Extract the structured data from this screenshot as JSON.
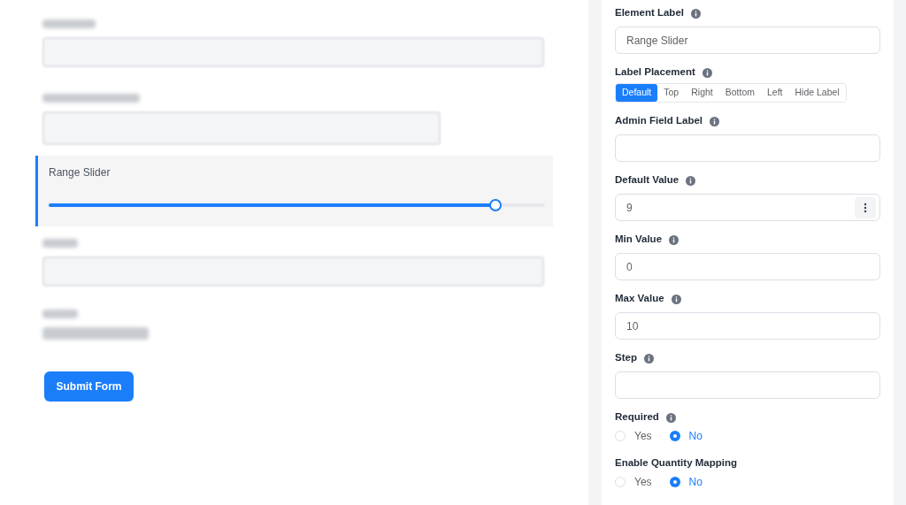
{
  "preview": {
    "slider": {
      "label": "Range Slider",
      "level": 0.9,
      "active": true
    },
    "submit": "Submit Form"
  },
  "settings": {
    "fields": [
      {
        "kind": "text",
        "label": "Element Label",
        "info": true,
        "value": "Range Slider"
      },
      {
        "kind": "segmented",
        "label": "Label Placement",
        "info": true,
        "options": [
          {
            "label": "Default",
            "selected": true
          },
          {
            "label": "Top",
            "selected": false
          },
          {
            "label": "Right",
            "selected": false
          },
          {
            "label": "Bottom",
            "selected": false
          },
          {
            "label": "Left",
            "selected": false
          },
          {
            "label": "Hide Label",
            "selected": false
          }
        ]
      },
      {
        "kind": "text",
        "label": "Admin Field Label",
        "info": true
      },
      {
        "kind": "number",
        "label": "Default Value",
        "info": true,
        "value": "9"
      },
      {
        "kind": "text",
        "label": "Min Value",
        "info": true,
        "value": "0"
      },
      {
        "kind": "text",
        "label": "Max Value",
        "info": true,
        "value": "10"
      },
      {
        "kind": "text",
        "label": "Step",
        "info": true
      },
      {
        "kind": "radio",
        "label": "Required",
        "info": true,
        "options": [
          {
            "label": "Yes",
            "selected": false
          },
          {
            "label": "No",
            "selected": true
          }
        ]
      },
      {
        "kind": "radio",
        "label": "Enable Quantity Mapping",
        "options": [
          {
            "label": "Yes",
            "selected": false
          },
          {
            "label": "No",
            "selected": true
          }
        ]
      }
    ]
  }
}
